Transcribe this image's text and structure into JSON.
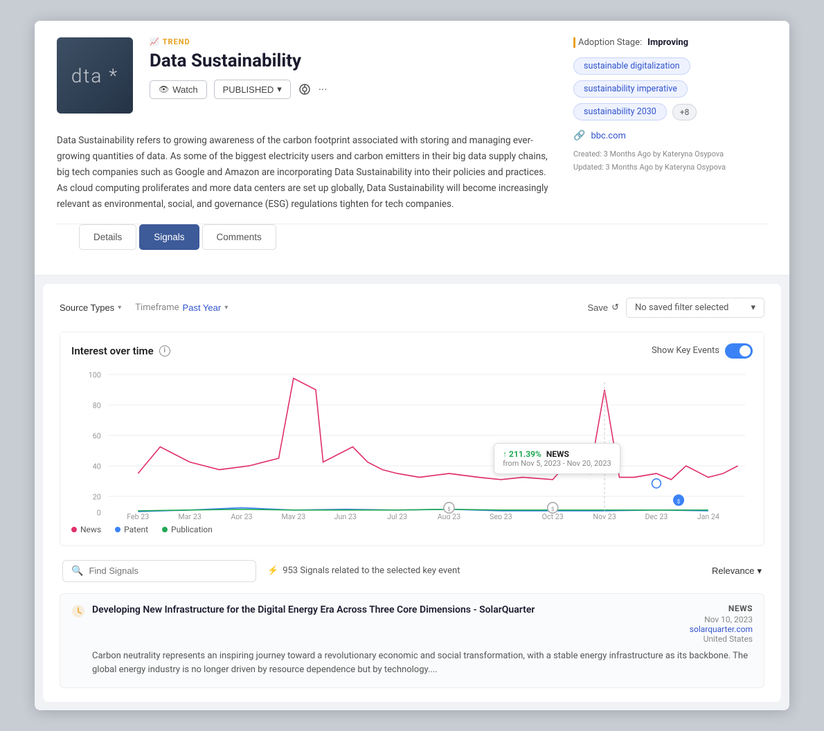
{
  "header": {
    "trend_label": "TREND",
    "title": "Data Sustainability",
    "watch_label": "Watch",
    "published_label": "PUBLISHED",
    "adoption_label": "Adoption Stage:",
    "adoption_value": "Improving",
    "tags": [
      "sustainable digitalization",
      "sustainability imperative",
      "sustainability 2030"
    ],
    "tags_more": "+8",
    "link": "bbc.com",
    "created": "Created: 3 Months Ago by Kateryna Osypova",
    "updated": "Updated: 3 Months Ago by Kateryna Osypova",
    "description": "Data Sustainability refers to growing awareness of the carbon footprint associated with storing and managing ever-growing quantities of data. As some of the biggest electricity users and carbon emitters in their big data supply chains, big tech companies such as Google and Amazon are incorporating Data Sustainability into their policies and practices. As cloud computing proliferates and more data centers are set up globally, Data Sustainability will become increasingly relevant as environmental, social, and governance (ESG) regulations tighten for tech companies."
  },
  "tabs": {
    "details_label": "Details",
    "signals_label": "Signals",
    "comments_label": "Comments"
  },
  "filters": {
    "source_types_label": "Source Types",
    "timeframe_label": "Timeframe",
    "timeframe_value": "Past Year",
    "save_label": "Save",
    "filter_placeholder": "No saved filter selected"
  },
  "chart": {
    "title": "Interest over time",
    "show_key_events_label": "Show Key Events",
    "x_labels": [
      "Feb 23",
      "Mar 23",
      "Apr 23",
      "May 23",
      "Jun 23",
      "Jul 23",
      "Aug 23",
      "Sep 23",
      "Oct 23",
      "Nov 23",
      "Dec 23",
      "Jan 24"
    ],
    "y_labels": [
      "0",
      "20",
      "40",
      "60",
      "80",
      "100"
    ],
    "tooltip_pct": "↑ 211.39%",
    "tooltip_source": "NEWS",
    "tooltip_from": "from Nov 5, 2023 - Nov 20, 2023",
    "legend": [
      {
        "label": "News",
        "color": "#e0306c"
      },
      {
        "label": "Patent",
        "color": "#3b82f6"
      },
      {
        "label": "Publication",
        "color": "#22a855"
      }
    ]
  },
  "signals_search": {
    "placeholder": "Find Signals",
    "count_text": "953 Signals related to the selected key event",
    "sort_label": "Relevance"
  },
  "signal_card": {
    "title": "Developing New Infrastructure for the Digital Energy Era Across Three Core Dimensions - SolarQuarter",
    "body": "Carbon neutrality represents an inspiring journey toward a revolutionary economic and social transformation, with a stable energy infrastructure as its backbone. The global energy industry is no longer driven by resource dependence but by technology....",
    "source_type": "NEWS",
    "date": "Nov 10, 2023",
    "domain": "solarquarter.com",
    "location": "United States"
  }
}
